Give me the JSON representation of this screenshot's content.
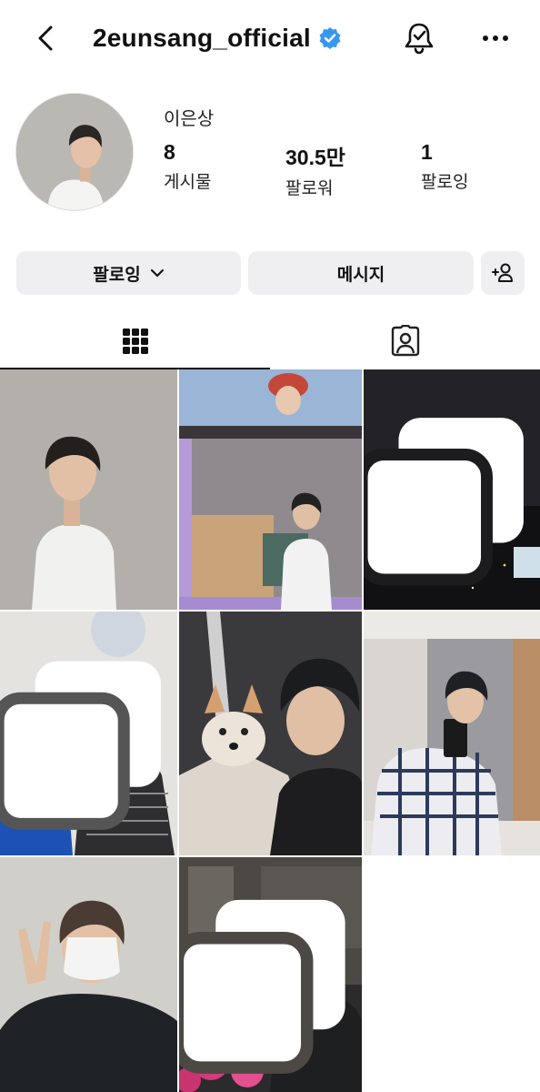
{
  "header": {
    "username": "2eunsang_official",
    "verified": true,
    "back_icon": "chevron-left-icon",
    "notifications_icon": "bell-check-icon",
    "more_icon": "more-horizontal-icon"
  },
  "profile": {
    "full_name": "이은상",
    "stats": [
      {
        "value": "8",
        "label": "게시물"
      },
      {
        "value": "30.5만",
        "label": "팔로워"
      },
      {
        "value": "1",
        "label": "팔로잉"
      }
    ]
  },
  "actions": {
    "following_label": "팔로잉",
    "message_label": "메시지",
    "add_user_icon": "add-user-icon"
  },
  "tabs": [
    {
      "name": "posts-grid",
      "icon": "grid-icon",
      "active": true
    },
    {
      "name": "tagged",
      "icon": "tagged-person-icon",
      "active": false
    }
  ],
  "posts": [
    {
      "id": 1,
      "multi": false
    },
    {
      "id": 2,
      "multi": false
    },
    {
      "id": 3,
      "multi": true
    },
    {
      "id": 4,
      "multi": true
    },
    {
      "id": 5,
      "multi": false
    },
    {
      "id": 6,
      "multi": false
    },
    {
      "id": 7,
      "multi": false
    },
    {
      "id": 8,
      "multi": true
    }
  ],
  "colors": {
    "verified_blue": "#3897f0",
    "button_bg": "#efeff2",
    "text": "#111111"
  }
}
